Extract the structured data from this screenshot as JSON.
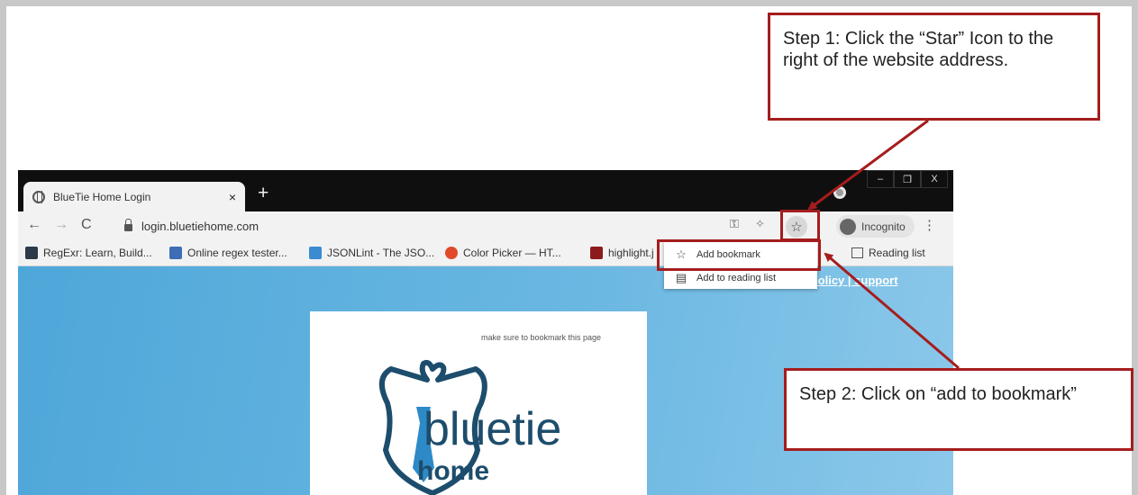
{
  "browser": {
    "tab_title": "BlueTie Home Login",
    "tab_close": "×",
    "new_tab": "+",
    "window_controls": [
      "–",
      "❐",
      "X"
    ],
    "url": "login.bluetiehome.com",
    "incognito_label": "Incognito",
    "bookmarks": [
      {
        "label": "RegExr: Learn, Build...",
        "color": "#2b3a48"
      },
      {
        "label": "Online regex tester...",
        "color": "#3d6db5"
      },
      {
        "label": "JSONLint - The JSO...",
        "color": "#3b8bd1"
      },
      {
        "label": "Color Picker — HT...",
        "color": "#e04a2a"
      },
      {
        "label": "highlight.j",
        "color": "#8d1b1b"
      }
    ],
    "reading_list": "Reading list"
  },
  "site": {
    "links": "terms of service | privacy policy | support",
    "bookmark_note": "make sure to bookmark this page",
    "logo_main": "bluetie",
    "logo_sub": "home"
  },
  "menu": {
    "add_bookmark": "Add bookmark",
    "add_reading_list": "Add to reading list"
  },
  "callouts": {
    "step1": "Step 1: Click the “Star” Icon to the right of the website address.",
    "step2": "Step 2: Click on “add to bookmark”"
  },
  "colors": {
    "accent": "#a51d1d",
    "page_blue": "#6bb8e2",
    "logo_blue": "#1d4d6c"
  }
}
